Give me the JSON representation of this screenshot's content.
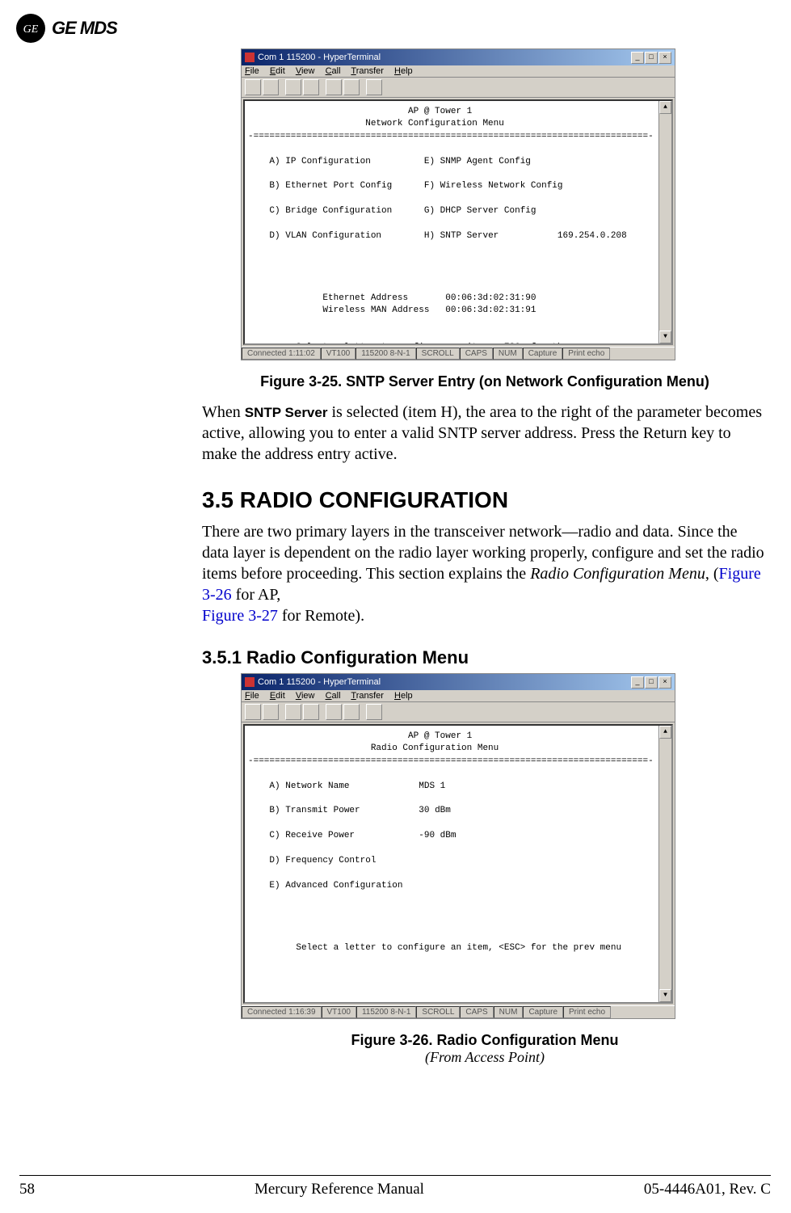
{
  "header": {
    "brand": "GE MDS"
  },
  "terminal_common": {
    "title": "Com 1 115200 - HyperTerminal",
    "menus": [
      "File",
      "Edit",
      "View",
      "Call",
      "Transfer",
      "Help"
    ],
    "prompt": "Select a letter to configure an item, <ESC> for the prev menu"
  },
  "terminal1": {
    "status_connected": "Connected 1:11:02",
    "status_emulation": "VT100",
    "status_port": "115200 8-N-1",
    "status_indicators": [
      "SCROLL",
      "CAPS",
      "NUM",
      "Capture",
      "Print echo"
    ],
    "screen": {
      "location": "AP @ Tower 1",
      "title": "Network Configuration Menu",
      "items_left": [
        {
          "key": "A",
          "label": "IP Configuration"
        },
        {
          "key": "B",
          "label": "Ethernet Port Config"
        },
        {
          "key": "C",
          "label": "Bridge Configuration"
        },
        {
          "key": "D",
          "label": "VLAN Configuration"
        }
      ],
      "items_right": [
        {
          "key": "E",
          "label": "SNMP Agent Config"
        },
        {
          "key": "F",
          "label": "Wireless Network Config"
        },
        {
          "key": "G",
          "label": "DHCP Server Config"
        },
        {
          "key": "H",
          "label": "SNTP Server",
          "value": "169.254.0.208"
        }
      ],
      "eth_addr_label": "Ethernet Address",
      "eth_addr": "00:06:3d:02:31:90",
      "wman_addr_label": "Wireless MAN Address",
      "wman_addr": "00:06:3d:02:31:91"
    }
  },
  "fig1_caption": "Figure 3-25. SNTP Server Entry (on Network Configuration Menu)",
  "para1_a": "When ",
  "para1_mono": "SNTP Server",
  "para1_b": " is selected (item H), the area to the right of the parameter becomes active, allowing you to enter a valid SNTP server address. Press the Return key to make the address entry active.",
  "section_heading": "3.5    RADIO CONFIGURATION",
  "para2_a": "There are two primary layers in the transceiver network—radio and data. Since the data layer is dependent on the radio layer working properly, configure and set the radio items before proceeding. This section explains the ",
  "para2_italic": "Radio Configuration Menu",
  "para2_b": ", (",
  "para2_link1": "Figure 3-26",
  "para2_c": " for AP, ",
  "para2_link2": "Figure 3-27",
  "para2_d": " for Remote).",
  "subsection_heading": "3.5.1 Radio Configuration Menu",
  "terminal2": {
    "status_connected": "Connected 1:16:39",
    "status_emulation": "VT100",
    "status_port": "115200 8-N-1",
    "status_indicators": [
      "SCROLL",
      "CAPS",
      "NUM",
      "Capture",
      "Print echo"
    ],
    "screen": {
      "location": "AP @ Tower 1",
      "title": "Radio Configuration Menu",
      "items": [
        {
          "key": "A",
          "label": "Network Name",
          "value": "MDS 1"
        },
        {
          "key": "B",
          "label": "Transmit Power",
          "value": "30 dBm"
        },
        {
          "key": "C",
          "label": "Receive Power",
          "value": "-90 dBm"
        },
        {
          "key": "D",
          "label": "Frequency Control"
        },
        {
          "key": "E",
          "label": "Advanced Configuration"
        }
      ]
    }
  },
  "fig2_caption": "Figure 3-26. Radio Configuration Menu",
  "fig2_sub": "(From Access Point)",
  "footer": {
    "page": "58",
    "center": "Mercury Reference Manual",
    "right": "05-4446A01, Rev. C"
  }
}
